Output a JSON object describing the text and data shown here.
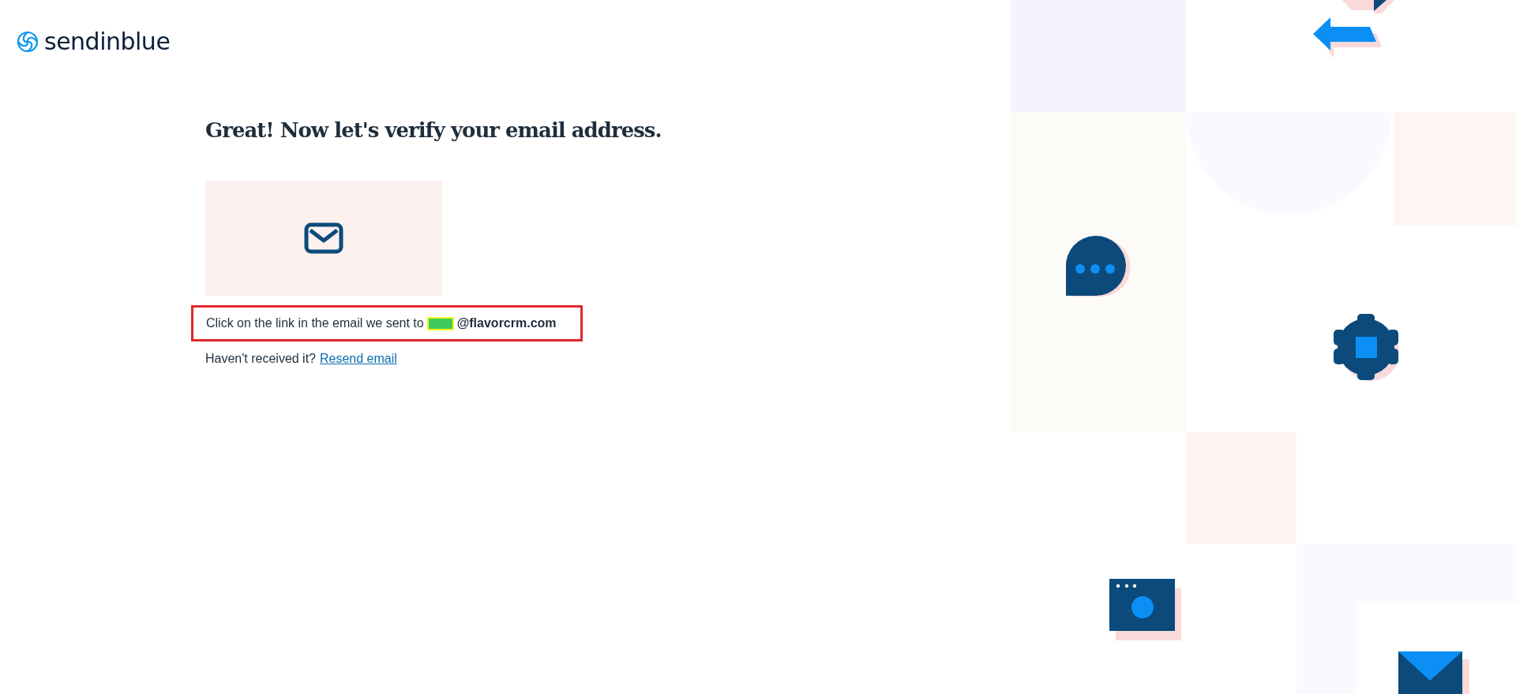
{
  "brand": {
    "name": "sendinblue"
  },
  "heading": "Great! Now let's verify your email address.",
  "instruction": {
    "text": "Click on the link in the email we sent to",
    "email_domain": "@flavorcrm.com"
  },
  "resend": {
    "prompt": "Haven't received it?",
    "link": "Resend email"
  }
}
